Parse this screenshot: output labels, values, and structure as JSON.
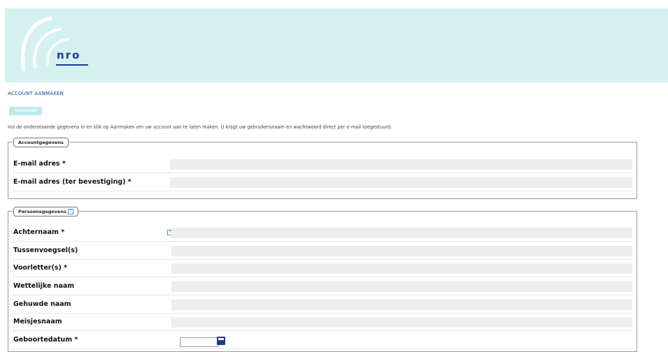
{
  "header": {
    "logo_text": "nro"
  },
  "page": {
    "title": "ACCOUNT AANMAKEN",
    "tab_label": "Aanmaken",
    "intro": "Vul de onderstaande gegevens in en klik op Aanmaken om uw account aan te laten maken. U krijgt uw gebruikersnaam en wachtwoord direct per e-mail toegestuurd."
  },
  "account": {
    "legend": "Accountgegevens",
    "fields": [
      {
        "label": "E-mail adres *",
        "value": ""
      },
      {
        "label": "E-mail adres (ter bevestiging) *",
        "value": ""
      }
    ]
  },
  "personal": {
    "legend": "Persoonsgegevens",
    "help_glyph": "?",
    "fields": [
      {
        "label": "Achternaam *",
        "value": ""
      },
      {
        "label": "Tussenvoegsel(s)",
        "value": ""
      },
      {
        "label": "Voorletter(s) *",
        "value": ""
      },
      {
        "label": "Wettelijke naam",
        "value": ""
      },
      {
        "label": "Gehuwde naam",
        "value": ""
      },
      {
        "label": "Meisjesnaam",
        "value": ""
      },
      {
        "label": "Geboortedatum *",
        "value": ""
      }
    ]
  },
  "colors": {
    "banner": "#d5f1ef",
    "accent": "#1e3a8a",
    "tab": "#bfe8ee"
  }
}
